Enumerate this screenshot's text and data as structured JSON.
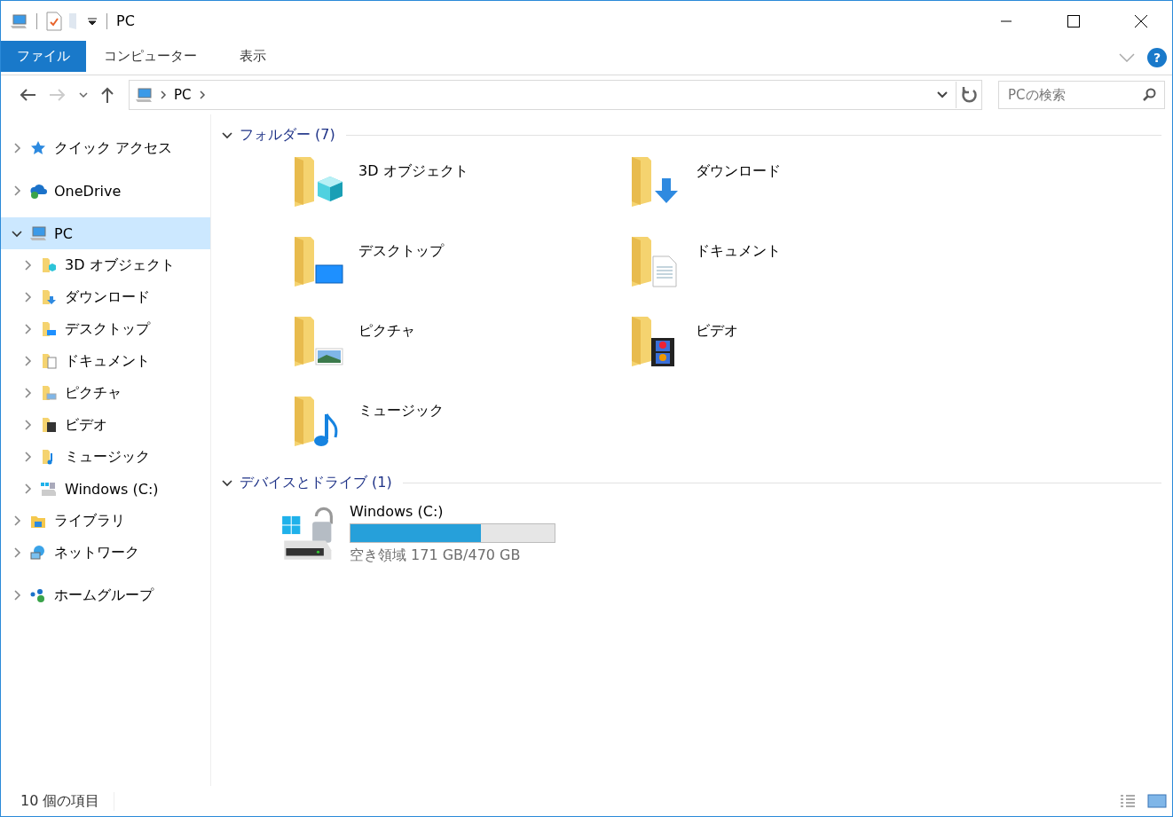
{
  "window": {
    "title": "PC"
  },
  "ribbon": {
    "tabs": [
      {
        "label": "ファイル",
        "kind": "file"
      },
      {
        "label": "コンピューター",
        "kind": "tab"
      },
      {
        "label": "表示",
        "kind": "tab"
      }
    ],
    "help": "?"
  },
  "address": {
    "path": [
      "PC"
    ],
    "search_placeholder": "PCの検索"
  },
  "sidebar": {
    "items": [
      {
        "label": "クイック アクセス",
        "kind": "star",
        "expanded": false,
        "selected": false
      },
      {
        "label": "OneDrive",
        "kind": "cloud",
        "expanded": false,
        "selected": false
      },
      {
        "label": "PC",
        "kind": "pc",
        "expanded": true,
        "selected": true,
        "children": [
          {
            "label": "3D オブジェクト",
            "kind": "cube",
            "expanded": false,
            "selected": false
          },
          {
            "label": "ダウンロード",
            "kind": "download",
            "expanded": false,
            "selected": false
          },
          {
            "label": "デスクトップ",
            "kind": "desktop",
            "expanded": false,
            "selected": false
          },
          {
            "label": "ドキュメント",
            "kind": "document",
            "expanded": false,
            "selected": false
          },
          {
            "label": "ピクチャ",
            "kind": "picture",
            "expanded": false,
            "selected": false
          },
          {
            "label": "ビデオ",
            "kind": "video",
            "expanded": false,
            "selected": false
          },
          {
            "label": "ミュージック",
            "kind": "music",
            "expanded": false,
            "selected": false
          },
          {
            "label": "Windows (C:)",
            "kind": "drive",
            "expanded": false,
            "selected": false
          }
        ]
      },
      {
        "label": "ライブラリ",
        "kind": "library",
        "expanded": false,
        "selected": false
      },
      {
        "label": "ネットワーク",
        "kind": "network",
        "expanded": false,
        "selected": false
      },
      {
        "label": "ホームグループ",
        "kind": "homegroup",
        "expanded": false,
        "selected": false
      }
    ]
  },
  "groups": [
    {
      "title": "フォルダー (7)",
      "expanded": true,
      "kind": "folders",
      "items": [
        {
          "label": "3D オブジェクト",
          "kind": "cube"
        },
        {
          "label": "ダウンロード",
          "kind": "download"
        },
        {
          "label": "デスクトップ",
          "kind": "desktop"
        },
        {
          "label": "ドキュメント",
          "kind": "document"
        },
        {
          "label": "ピクチャ",
          "kind": "picture"
        },
        {
          "label": "ビデオ",
          "kind": "video"
        },
        {
          "label": "ミュージック",
          "kind": "music"
        }
      ]
    },
    {
      "title": "デバイスとドライブ (1)",
      "expanded": true,
      "kind": "drives",
      "items": [
        {
          "label": "Windows (C:)",
          "kind": "drive",
          "level": 0.64,
          "free": "空き領域 171 GB/470 GB"
        }
      ]
    }
  ],
  "status_bar": {
    "count": "10 個の項目"
  }
}
